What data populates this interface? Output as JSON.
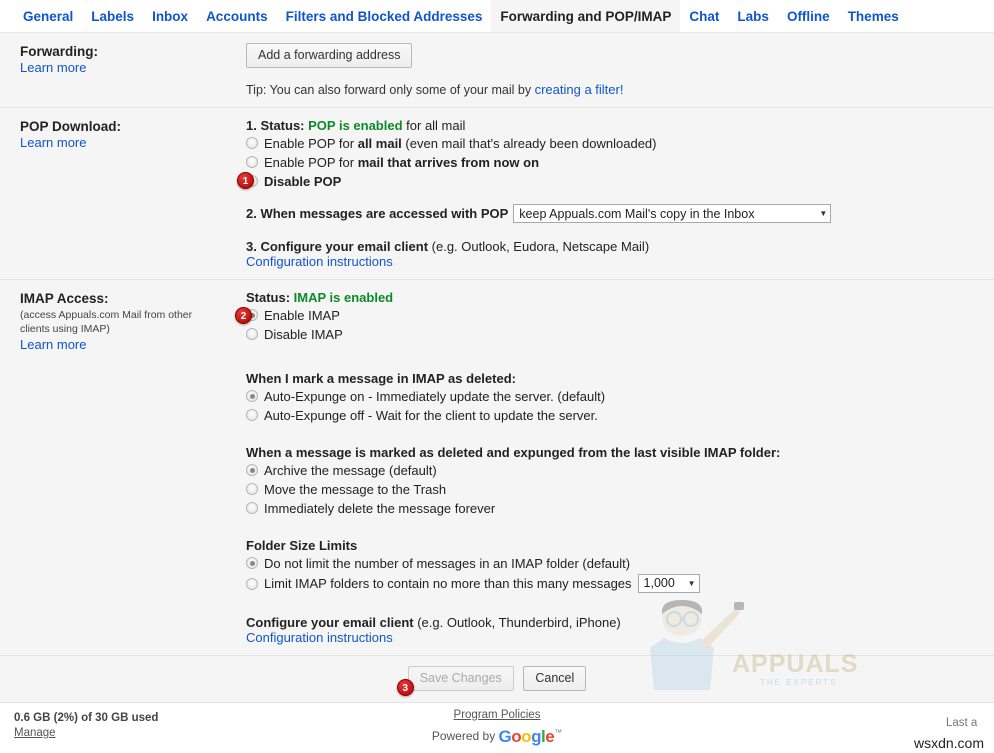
{
  "tabs": [
    {
      "label": "General",
      "active": false
    },
    {
      "label": "Labels",
      "active": false
    },
    {
      "label": "Inbox",
      "active": false
    },
    {
      "label": "Accounts",
      "active": false
    },
    {
      "label": "Filters and Blocked Addresses",
      "active": false
    },
    {
      "label": "Forwarding and POP/IMAP",
      "active": true
    },
    {
      "label": "Chat",
      "active": false
    },
    {
      "label": "Labs",
      "active": false
    },
    {
      "label": "Offline",
      "active": false
    },
    {
      "label": "Themes",
      "active": false
    }
  ],
  "forwarding": {
    "title": "Forwarding:",
    "learn_more": "Learn more",
    "add_button": "Add a forwarding address",
    "tip_prefix": "Tip: You can also forward only some of your mail by ",
    "tip_link": "creating a filter!"
  },
  "pop": {
    "title": "POP Download:",
    "learn_more": "Learn more",
    "step1_prefix": "1. Status: ",
    "step1_status": "POP is enabled",
    "step1_suffix": " for all mail",
    "options": [
      {
        "pre": "Enable POP for ",
        "bold": "all mail",
        "post": " (even mail that's already been downloaded)",
        "checked": false
      },
      {
        "pre": "Enable POP for ",
        "bold": "mail that arrives from now on",
        "post": "",
        "checked": false
      },
      {
        "pre": "",
        "bold": "Disable POP",
        "post": "",
        "checked": false
      }
    ],
    "step2_label": "2. When messages are accessed with POP",
    "step2_value": "keep Appuals.com Mail's copy in the Inbox",
    "step3_bold": "3. Configure your email client",
    "step3_rest": " (e.g. Outlook, Eudora, Netscape Mail)",
    "step3_link": "Configuration instructions"
  },
  "imap": {
    "title": "IMAP Access:",
    "note": "(access Appuals.com Mail from other clients using IMAP)",
    "learn_more": "Learn more",
    "status_prefix": "Status: ",
    "status_value": "IMAP is enabled",
    "toggle_options": [
      {
        "label": "Enable IMAP",
        "checked": true
      },
      {
        "label": "Disable IMAP",
        "checked": false
      }
    ],
    "expunge_title": "When I mark a message in IMAP as deleted:",
    "expunge_options": [
      {
        "label": "Auto-Expunge on - Immediately update the server. (default)",
        "checked": true
      },
      {
        "label": "Auto-Expunge off - Wait for the client to update the server.",
        "checked": false
      }
    ],
    "deleted_title": "When a message is marked as deleted and expunged from the last visible IMAP folder:",
    "deleted_options": [
      {
        "label": "Archive the message (default)",
        "checked": true
      },
      {
        "label": "Move the message to the Trash",
        "checked": false
      },
      {
        "label": "Immediately delete the message forever",
        "checked": false
      }
    ],
    "folder_title": "Folder Size Limits",
    "folder_options": [
      {
        "label": "Do not limit the number of messages in an IMAP folder (default)",
        "checked": true
      },
      {
        "label": "Limit IMAP folders to contain no more than this many messages",
        "checked": false
      }
    ],
    "folder_limit_value": "1,000",
    "configure_bold": "Configure your email client",
    "configure_rest": " (e.g. Outlook, Thunderbird, iPhone)",
    "configure_link": "Configuration instructions"
  },
  "actions": {
    "save_label": "Save Changes",
    "cancel_label": "Cancel"
  },
  "footer": {
    "storage": "0.6 GB (2%) of 30 GB used",
    "manage": "Manage",
    "program_policies": "Program Policies",
    "powered_by": "Powered by",
    "google": "Google",
    "last_activity": "Last a",
    "site_mark": "wsxdn.com"
  },
  "badges": [
    {
      "number": "1"
    },
    {
      "number": "2"
    },
    {
      "number": "3"
    }
  ],
  "watermark": {
    "brand": "APPUALS",
    "tagline": "THE EXPERTS"
  },
  "icons": {
    "dropdown": "▼"
  }
}
